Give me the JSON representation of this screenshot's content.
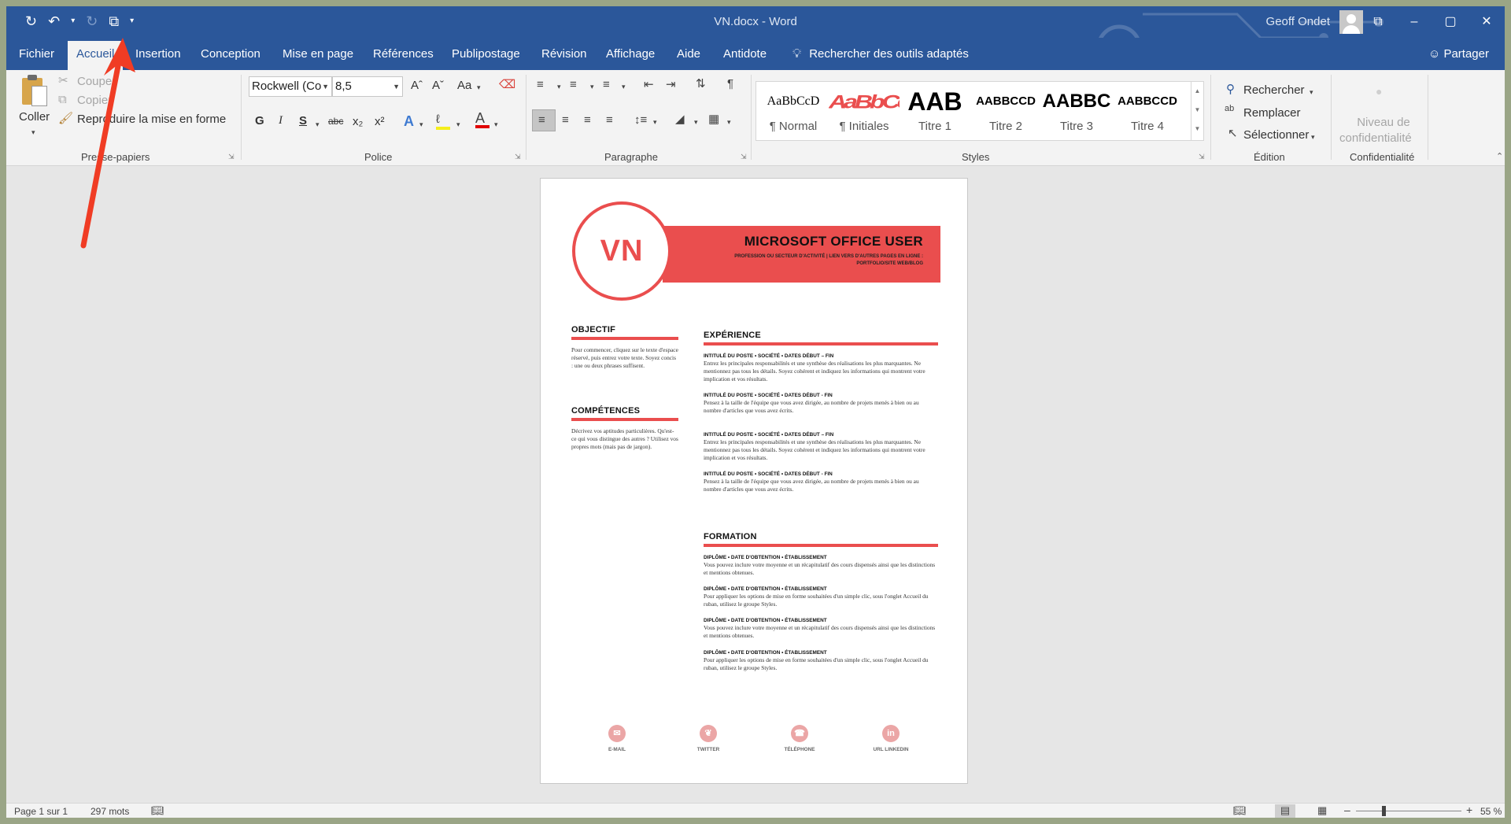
{
  "window": {
    "title": "VN.docx - Word",
    "user": "Geoff Ondet",
    "controls": [
      "⧉",
      "–",
      "▢",
      "✕"
    ]
  },
  "qat": {
    "save": "↻",
    "undo": "↶",
    "undo_arrow": "▾",
    "redo": "↻",
    "copy": "⧉",
    "customize": "▾"
  },
  "tabs": [
    "Fichier",
    "Accueil",
    "Insertion",
    "Conception",
    "Mise en page",
    "Références",
    "Publipostage",
    "Révision",
    "Affichage",
    "Aide",
    "Antidote"
  ],
  "active_tab": "Accueil",
  "tell_me": "Rechercher des outils adaptés",
  "share": "Partager",
  "clipboard": {
    "paste": "Coller",
    "cut": "Couper",
    "copy": "Copier",
    "format_painter": "Reproduire la mise en forme",
    "label": "Presse-papiers"
  },
  "font": {
    "name": "Rockwell (Co",
    "size": "8,5",
    "grow": "Aˆ",
    "shrink": "Aˇ",
    "case": "Aa",
    "bold": "G",
    "italic": "I",
    "underline": "S",
    "strike": "abc",
    "subscript": "x₂",
    "superscript": "x²",
    "label": "Police"
  },
  "paragraph": {
    "label": "Paragraphe"
  },
  "styles": {
    "label": "Styles",
    "items": [
      {
        "preview": "AaBbCcD",
        "name": "¶ Normal"
      },
      {
        "preview": "AaBbCcD",
        "name": "¶ Initiales"
      },
      {
        "preview": "AAB",
        "name": "Titre 1"
      },
      {
        "preview": "AABBCCD",
        "name": "Titre 2"
      },
      {
        "preview": "AABBC",
        "name": "Titre 3"
      },
      {
        "preview": "AABBCCD",
        "name": "Titre 4"
      }
    ]
  },
  "editing": {
    "find": "Rechercher",
    "replace": "Remplacer",
    "select": "Sélectionner",
    "label": "Édition"
  },
  "sensitivity": {
    "level1": "Niveau de",
    "level2": "confidentialité",
    "label": "Confidentialité"
  },
  "document": {
    "initials": "VN",
    "name": "MICROSOFT OFFICE USER",
    "subtitle": "PROFESSION OU SECTEUR D'ACTIVITÉ | LIEN VERS D'AUTRES PAGES EN LIGNE : PORTFOLIO/SITE WEB/BLOG",
    "objective_title": "OBJECTIF",
    "objective_text": "Pour commencer, cliquez sur le texte d'espace réservé, puis entrez votre texte. Soyez concis : une ou deux phrases suffisent.",
    "skills_title": "COMPÉTENCES",
    "skills_text": "Décrivez vos aptitudes particulières. Qu'est-ce qui vous distingue des autres ? Utilisez vos propres mots (mais pas de jargon).",
    "experience_title": "EXPÉRIENCE",
    "experience": [
      {
        "head": "INTITULÉ DU POSTE • SOCIÉTÉ • DATES DÉBUT – FIN",
        "text": "Entrez les principales responsabilités et une synthèse des réalisations les plus marquantes. Ne mentionnez pas tous les détails. Soyez cohérent et indiquez les informations qui montrent votre implication et vos résultats."
      },
      {
        "head": "INTITULÉ DU POSTE • SOCIÉTÉ • DATES DÉBUT - FIN",
        "text": "Pensez à la taille de l'équipe que vous avez dirigée, au nombre de projets menés à bien ou au nombre d'articles que vous avez écrits."
      },
      {
        "head": "INTITULÉ DU POSTE • SOCIÉTÉ • DATES DÉBUT – FIN",
        "text": "Entrez les principales responsabilités et une synthèse des réalisations les plus marquantes. Ne mentionnez pas tous les détails. Soyez cohérent et indiquez les informations qui montrent votre implication et vos résultats."
      },
      {
        "head": "INTITULÉ DU POSTE • SOCIÉTÉ • DATES DÉBUT - FIN",
        "text": "Pensez à la taille de l'équipe que vous avez dirigée, au nombre de projets menés à bien ou au nombre d'articles que vous avez écrits."
      }
    ],
    "education_title": "FORMATION",
    "education": [
      {
        "head": "DIPLÔME • DATE D'OBTENTION • ÉTABLISSEMENT",
        "text": "Vous pouvez inclure votre moyenne et un récapitulatif des cours dispensés ainsi que les distinctions et mentions obtenues."
      },
      {
        "head": "DIPLÔME • DATE D'OBTENTION • ÉTABLISSEMENT",
        "text": "Pour appliquer les options de mise en forme souhaitées d'un simple clic, sous l'onglet Accueil du ruban, utilisez le groupe Styles."
      },
      {
        "head": "DIPLÔME • DATE D'OBTENTION • ÉTABLISSEMENT",
        "text": "Vous pouvez inclure votre moyenne et un récapitulatif des cours dispensés ainsi que les distinctions et mentions obtenues."
      },
      {
        "head": "DIPLÔME • DATE D'OBTENTION • ÉTABLISSEMENT",
        "text": "Pour appliquer les options de mise en forme souhaitées d'un simple clic, sous l'onglet Accueil du ruban, utilisez le groupe Styles."
      }
    ],
    "socials": [
      {
        "icon": "✉",
        "label": "E-MAIL"
      },
      {
        "icon": "❦",
        "label": "TWITTER"
      },
      {
        "icon": "☎",
        "label": "TÉLÉPHONE"
      },
      {
        "icon": "in",
        "label": "URL LINKEDIN"
      }
    ]
  },
  "status": {
    "page": "Page 1 sur 1",
    "words": "297 mots",
    "zoom_minus": "–",
    "zoom_plus": "+",
    "zoom": "55 %",
    "zoom_value": 55
  },
  "colors": {
    "title_bar": "#2b579a",
    "accent_red": "#ea4e4e",
    "annotation_arrow": "#f03c24"
  }
}
